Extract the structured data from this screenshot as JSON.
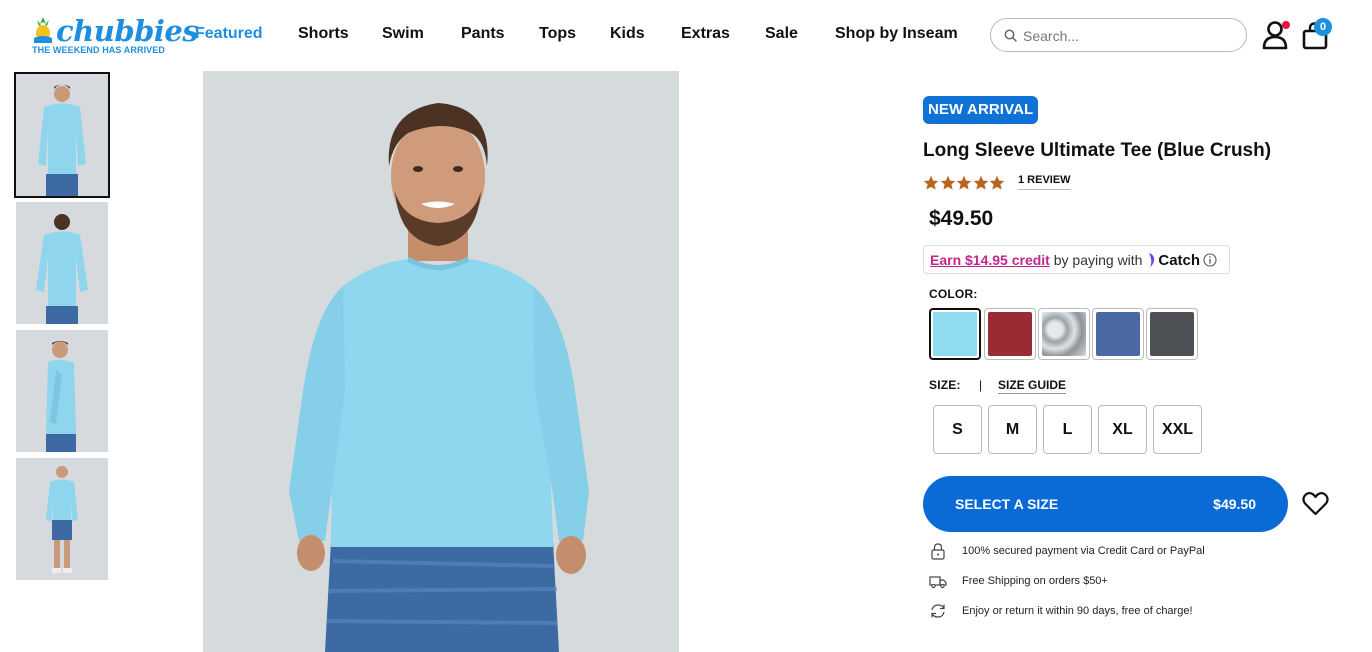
{
  "brand": {
    "name": "chubbies",
    "tagline": "THE WEEKEND HAS ARRIVED",
    "color": "#1e8fe0"
  },
  "nav": {
    "items": [
      {
        "label": "Featured",
        "active": true
      },
      {
        "label": "Shorts"
      },
      {
        "label": "Swim"
      },
      {
        "label": "Pants"
      },
      {
        "label": "Tops"
      },
      {
        "label": "Kids"
      },
      {
        "label": "Extras"
      },
      {
        "label": "Sale"
      },
      {
        "label": "Shop by Inseam"
      }
    ]
  },
  "search": {
    "placeholder": "Search..."
  },
  "cart": {
    "count": "0"
  },
  "gallery": {
    "thumbnails": [
      {
        "view": "front",
        "selected": true
      },
      {
        "view": "back"
      },
      {
        "view": "side"
      },
      {
        "view": "full-body"
      }
    ]
  },
  "product": {
    "badge": "NEW ARRIVAL",
    "title": "Long Sleeve Ultimate Tee (Blue Crush)",
    "rating": 5,
    "review_label": "1 REVIEW",
    "price": "$49.50",
    "catch": {
      "link": "Earn $14.95 credit",
      "text": " by paying with ",
      "brand": "Catch"
    },
    "color_label": "COLOR:",
    "colors": [
      {
        "name": "Blue Crush",
        "hex": "#8fdcf0",
        "selected": true
      },
      {
        "name": "Maroon",
        "hex": "#9a2b35"
      },
      {
        "name": "Grey Tie-Dye",
        "hex": "#b7bbbf"
      },
      {
        "name": "Navy Heather",
        "hex": "#4a69a3"
      },
      {
        "name": "Charcoal",
        "hex": "#4d5155"
      }
    ],
    "size_label": "SIZE:",
    "size_separator": "|",
    "size_guide": "SIZE GUIDE",
    "sizes": [
      "S",
      "M",
      "L",
      "XL",
      "XXL"
    ],
    "cta_label": "SELECT A SIZE",
    "cta_price": "$49.50",
    "cta_color": "#0a6ad6",
    "perks": [
      {
        "icon": "lock-icon",
        "text": "100% secured payment via Credit Card or PayPal"
      },
      {
        "icon": "truck-icon",
        "text": "Free Shipping on orders $50+"
      },
      {
        "icon": "return-icon",
        "text": "Enjoy or return it within 90 days, free of charge!"
      }
    ]
  }
}
